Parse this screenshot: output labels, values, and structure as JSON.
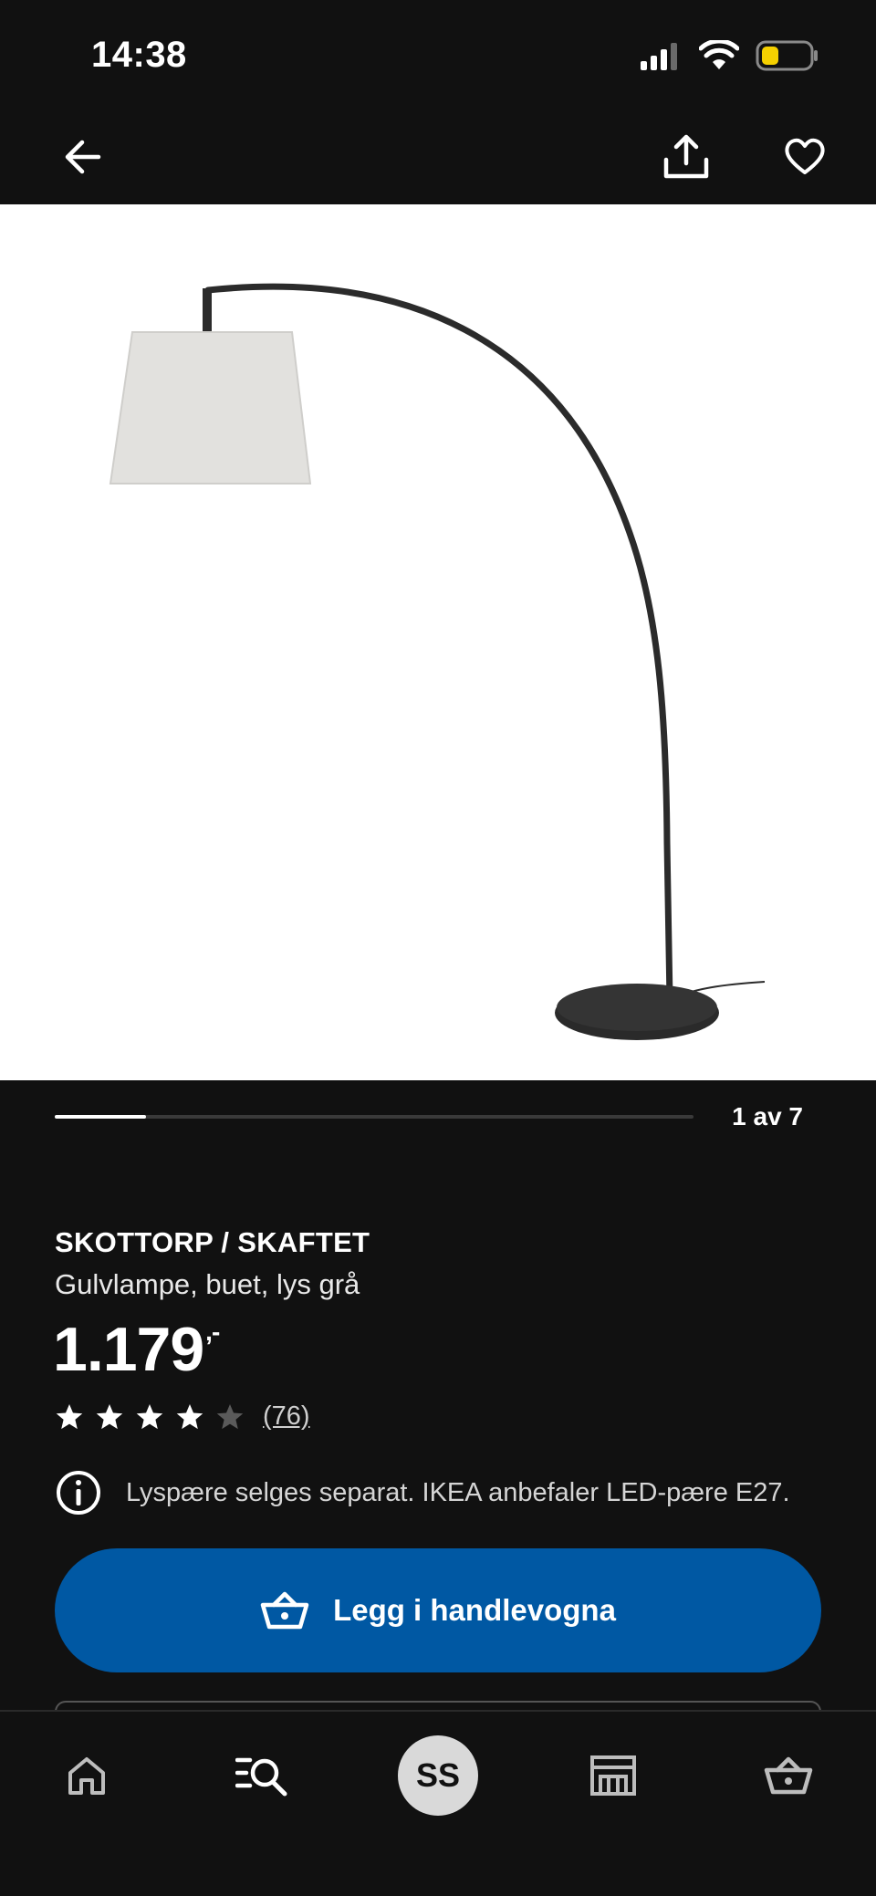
{
  "status_bar": {
    "time": "14:38",
    "icons": [
      "cellular-signal-icon",
      "wifi-icon",
      "battery-icon"
    ],
    "battery_color": "#f5d000"
  },
  "top_nav": {
    "icons": [
      "arrow-left-icon",
      "share-icon",
      "heart-icon"
    ]
  },
  "gallery": {
    "counter": "1 av 7",
    "current": 1,
    "total": 7
  },
  "product": {
    "name": "SKOTTORP / SKAFTET",
    "description": "Gulvlampe, buet, lys grå",
    "price": "1.179",
    "price_suffix": ",-",
    "rating": 4,
    "rating_max": 5,
    "review_count": "(76)",
    "info_icon": "info-icon",
    "info": "Lyspære selges separat. IKEA anbefaler LED-pære E27."
  },
  "cart_button": {
    "icon": "basket-icon",
    "label": "Legg i handlevogna",
    "color": "#0058a3"
  },
  "bottom_nav": {
    "items": [
      {
        "icon": "home-icon"
      },
      {
        "icon": "search-list-icon"
      },
      {
        "avatar_initials": "SS"
      },
      {
        "icon": "store-icon"
      },
      {
        "icon": "basket-icon"
      }
    ]
  },
  "colors": {
    "background": "#111111",
    "accent": "#0058a3",
    "text": "#ffffff"
  }
}
